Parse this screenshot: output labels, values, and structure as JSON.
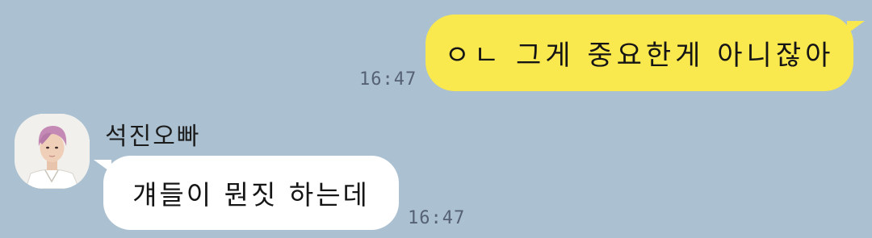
{
  "theme": {
    "background": "#abc1d1",
    "outgoing_bubble": "#fae84f",
    "incoming_bubble": "#ffffff"
  },
  "messages": [
    {
      "direction": "outgoing",
      "text": "ㅇㄴ 그게 중요한게 아니잖아",
      "time": "16:47"
    },
    {
      "direction": "incoming",
      "sender": "석진오빠",
      "avatar": "profile-photo",
      "text": "걔들이 뭔짓 하는데",
      "time": "16:47"
    }
  ]
}
